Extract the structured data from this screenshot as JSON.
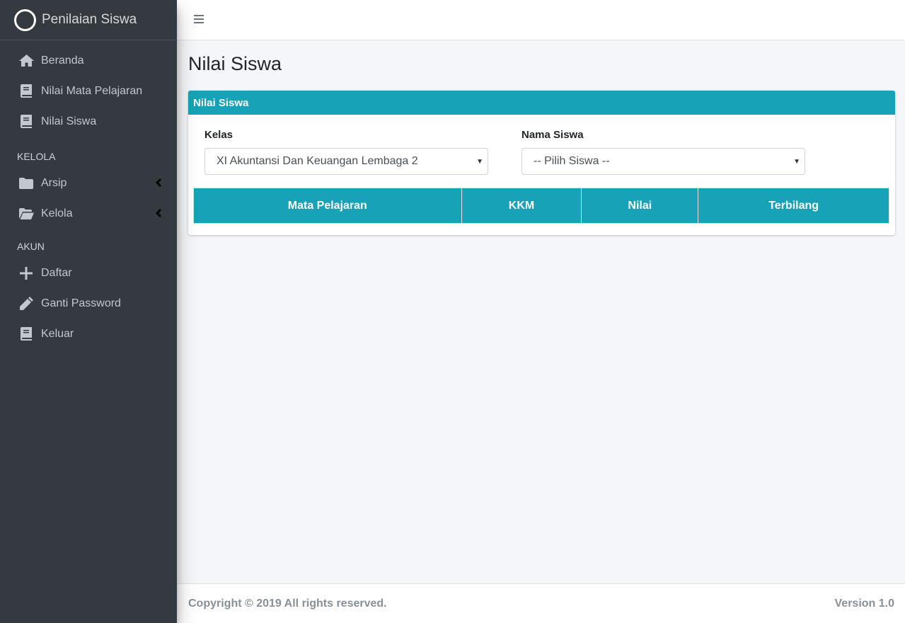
{
  "brand": {
    "title": "Penilaian Siswa"
  },
  "sidebar": {
    "items": [
      {
        "label": "Beranda",
        "icon": "home-icon"
      },
      {
        "label": "Nilai Mata Pelajaran",
        "icon": "book-icon"
      },
      {
        "label": "Nilai Siswa",
        "icon": "book-icon"
      }
    ],
    "kelola_header": "KELOLA",
    "kelola_items": [
      {
        "label": "Arsip",
        "icon": "folder-icon"
      },
      {
        "label": "Kelola",
        "icon": "folder-open-icon"
      }
    ],
    "akun_header": "AKUN",
    "akun_items": [
      {
        "label": "Daftar",
        "icon": "plus-icon"
      },
      {
        "label": "Ganti Password",
        "icon": "pencil-icon"
      },
      {
        "label": "Keluar",
        "icon": "book-icon"
      }
    ]
  },
  "page": {
    "title": "Nilai Siswa"
  },
  "card": {
    "title": "Nilai Siswa",
    "kelas_label": "Kelas",
    "kelas_value": "XI Akuntansi Dan Keuangan Lembaga 2",
    "siswa_label": "Nama Siswa",
    "siswa_value": "-- Pilih Siswa --",
    "columns": [
      "Mata Pelajaran",
      "KKM",
      "Nilai",
      "Terbilang"
    ]
  },
  "footer": {
    "copyright": "Copyright © 2019 All rights reserved.",
    "version": "Version 1.0"
  },
  "colors": {
    "sidebar_bg": "#343a40",
    "accent": "#17a2b8",
    "content_bg": "#f4f6f9"
  }
}
